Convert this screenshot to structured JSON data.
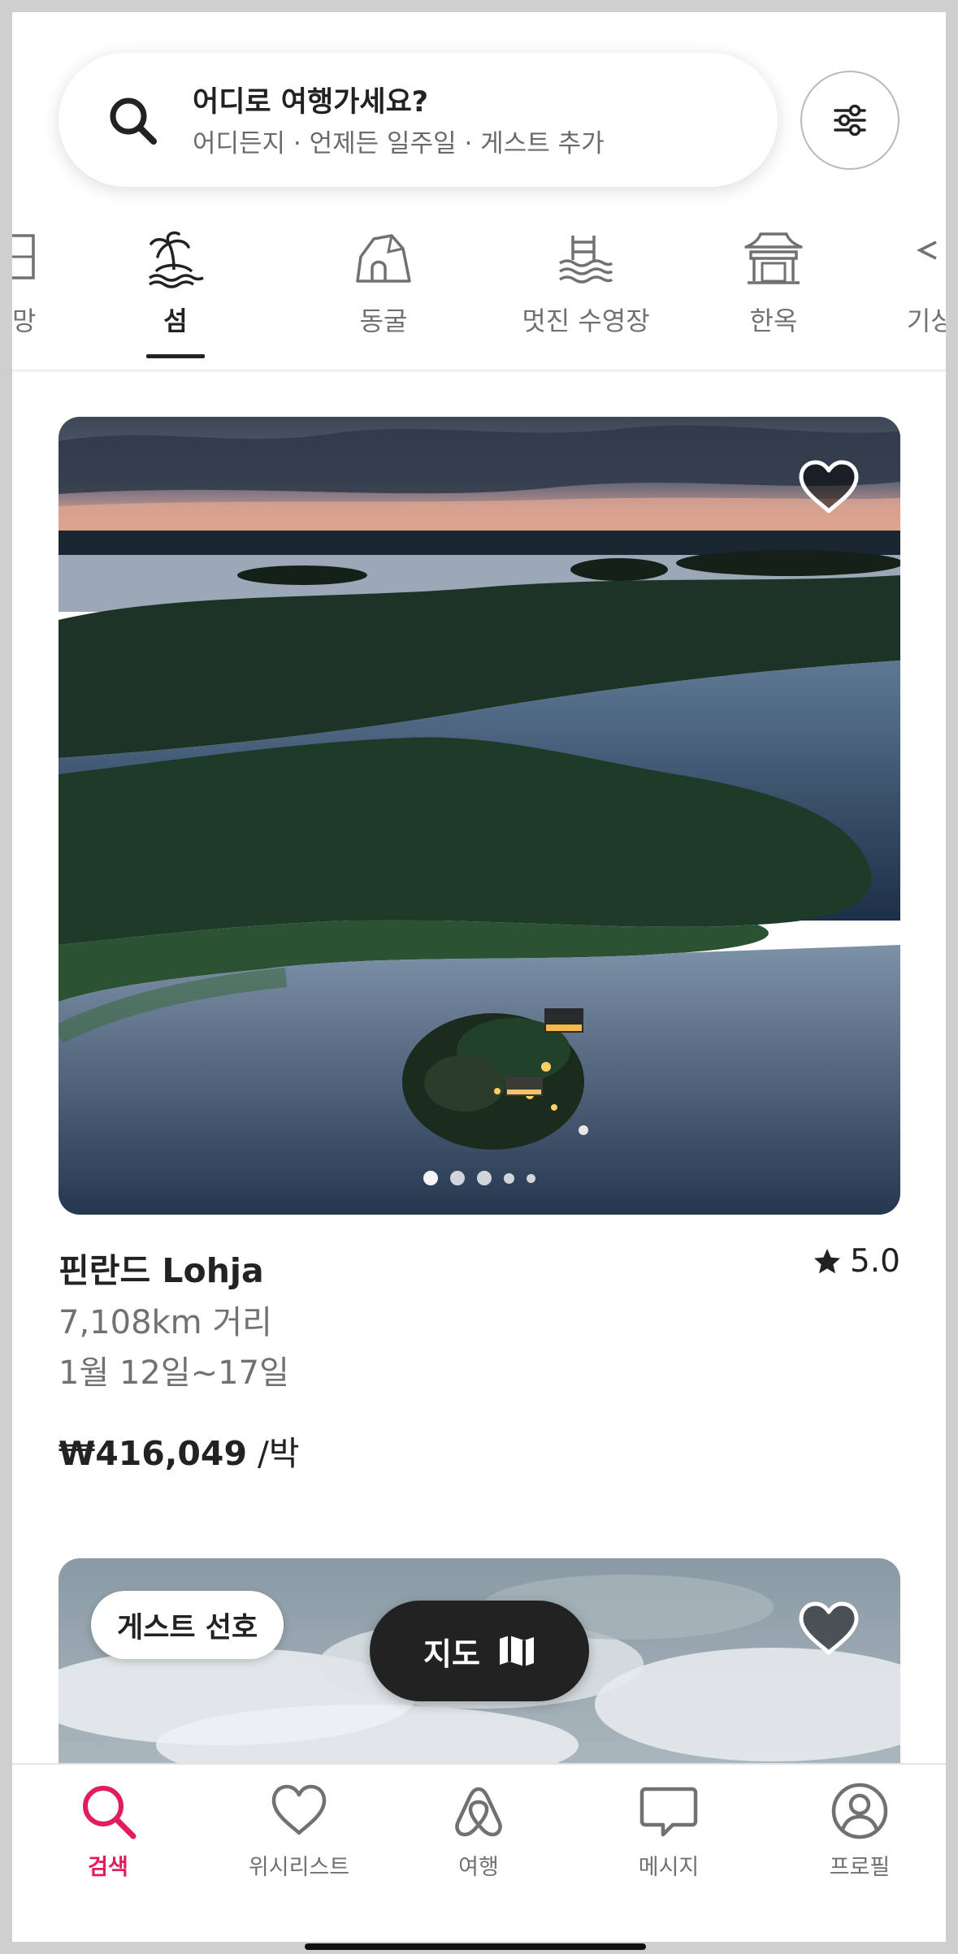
{
  "search": {
    "title": "어디로 여행가세요?",
    "subtitle": "어디든지 · 언제든 일주일 · 게스트 추가"
  },
  "categories": [
    {
      "label": "전망",
      "icon": "view-icon",
      "active": false
    },
    {
      "label": "섬",
      "icon": "island-icon",
      "active": true
    },
    {
      "label": "동굴",
      "icon": "cave-icon",
      "active": false
    },
    {
      "label": "멋진 수영장",
      "icon": "pool-icon",
      "active": false
    },
    {
      "label": "한옥",
      "icon": "hanok-icon",
      "active": false
    },
    {
      "label": "기상천",
      "icon": "unique-icon",
      "active": false
    }
  ],
  "listing1": {
    "title": "핀란드 Lohja",
    "rating": "5.0",
    "distance": "7,108km 거리",
    "dates": "1월 12일~17일",
    "price": "₩416,049",
    "price_unit": " /박",
    "photo_count": 5,
    "photo_index": 1
  },
  "listing2": {
    "badge": "게스트 선호"
  },
  "map_button": {
    "label": "지도"
  },
  "tabs": [
    {
      "label": "검색",
      "icon": "search-icon",
      "active": true
    },
    {
      "label": "위시리스트",
      "icon": "heart-icon",
      "active": false
    },
    {
      "label": "여행",
      "icon": "airbnb-logo-icon",
      "active": false
    },
    {
      "label": "메시지",
      "icon": "message-icon",
      "active": false
    },
    {
      "label": "프로필",
      "icon": "profile-icon",
      "active": false
    }
  ],
  "colors": {
    "accent": "#e31c5f",
    "text": "#222222",
    "muted": "#717171"
  }
}
